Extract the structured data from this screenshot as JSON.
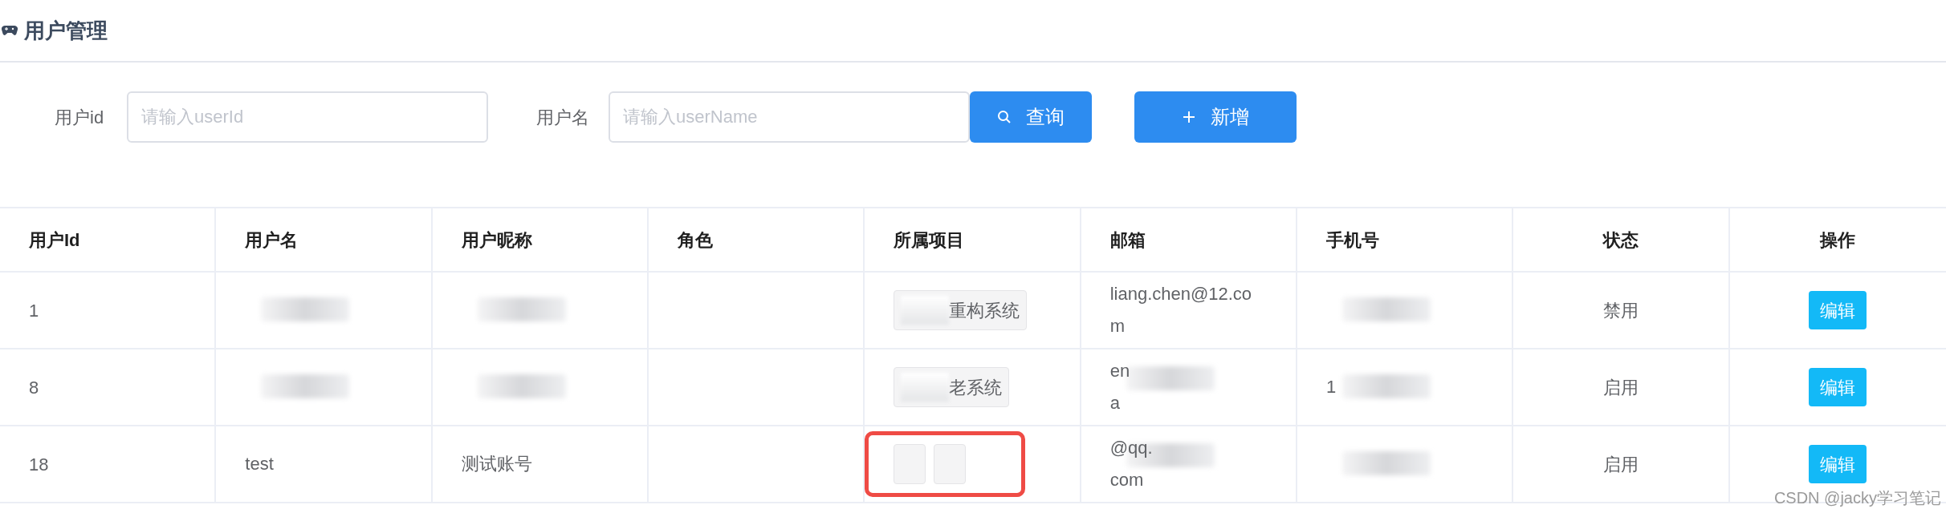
{
  "page": {
    "title": "用户管理"
  },
  "filters": [
    {
      "label": "用户id",
      "placeholder": "请输入userId"
    },
    {
      "label": "用户名",
      "placeholder": "请输入userName"
    }
  ],
  "buttons": [
    {
      "kind": "search",
      "label": "查询"
    },
    {
      "kind": "add",
      "label": "新增"
    }
  ],
  "table": {
    "columns": [
      {
        "label": "用户Id"
      },
      {
        "label": "用户名"
      },
      {
        "label": "用户昵称"
      },
      {
        "label": "角色"
      },
      {
        "label": "所属项目"
      },
      {
        "label": "邮箱"
      },
      {
        "label": "手机号"
      },
      {
        "label": "状态"
      },
      {
        "label": "操作"
      }
    ],
    "rows": [
      {
        "id": "1",
        "name": {
          "redacted": true
        },
        "nickname": {
          "redacted": true
        },
        "projects": [
          {
            "text": "重构系统",
            "redacted": true
          }
        ],
        "projects_highlighted": false,
        "email": {
          "lines": [
            "liang.chen@12.co",
            "m"
          ],
          "redacted": false
        },
        "phone": {
          "redacted": true
        },
        "status": "禁用",
        "action": "编辑"
      },
      {
        "id": "8",
        "name": {
          "redacted": true
        },
        "nickname": {
          "redacted": true
        },
        "projects": [
          {
            "text": "老系统",
            "redacted": true
          }
        ],
        "projects_highlighted": false,
        "email": {
          "lines": [
            "en",
            "a"
          ],
          "redacted": true
        },
        "phone": {
          "lines": [
            "1"
          ],
          "redacted": true
        },
        "status": "启用",
        "action": "编辑"
      },
      {
        "id": "18",
        "name": {
          "lines": [
            "test"
          ],
          "redacted": false
        },
        "nickname": {
          "lines": [
            "测试账号"
          ],
          "redacted": false
        },
        "projects": [
          {
            "redacted": false
          },
          {
            "redacted": false
          }
        ],
        "projects_highlighted": true,
        "email": {
          "lines": [
            "@qq.",
            "com"
          ],
          "redacted": true
        },
        "phone": {
          "redacted": true
        },
        "status": "启用",
        "action": "编辑"
      }
    ]
  },
  "watermark_note": {
    "text": "CSDN @jacky学习笔记"
  }
}
